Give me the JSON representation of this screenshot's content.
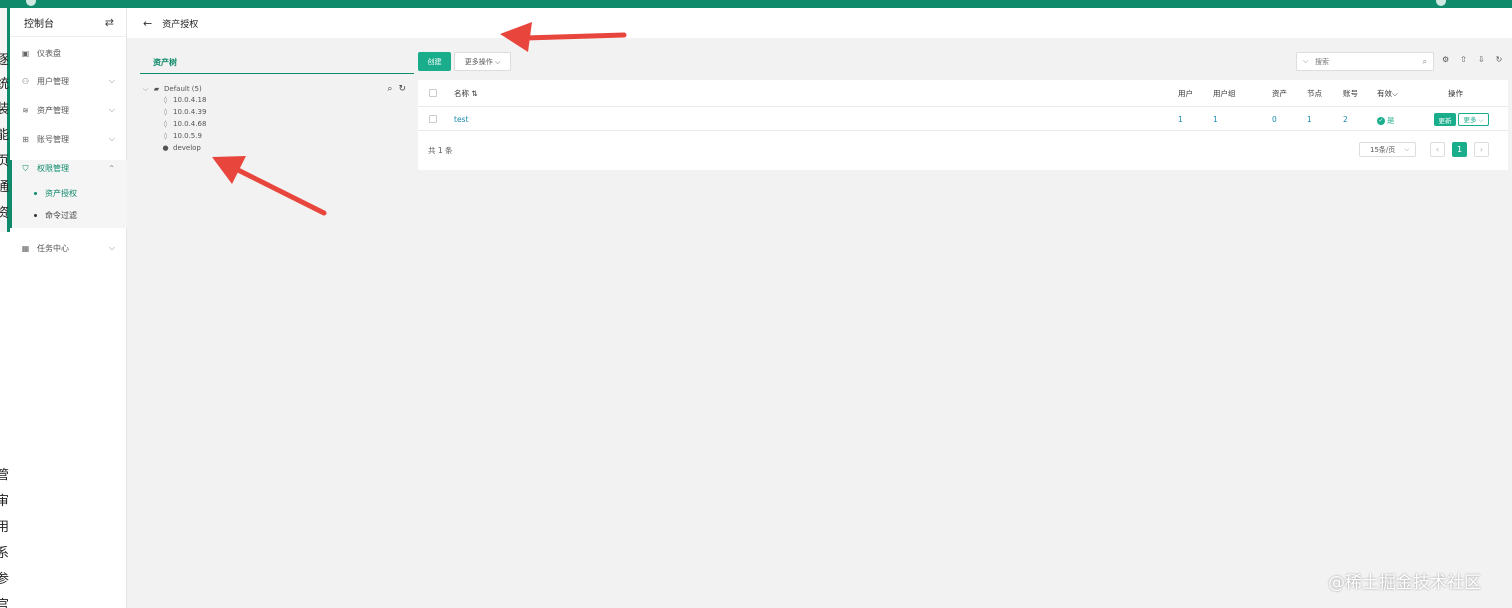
{
  "colors": {
    "accent": "#1aad8b",
    "topbar": "#0f8a6a",
    "link": "#1a8ab0",
    "annotation": "#e8463c"
  },
  "left_edge_chars": [
    "逐",
    "统",
    "装",
    "能",
    "页",
    "通",
    "资",
    "管",
    "审",
    "用",
    "系",
    "参",
    "官"
  ],
  "sidebar": {
    "title": "控制台",
    "swap_icon": "⇄",
    "items": [
      {
        "label": "仪表盘",
        "icon": "dashboard-icon"
      },
      {
        "label": "用户管理",
        "icon": "users-icon"
      },
      {
        "label": "资产管理",
        "icon": "assets-icon"
      },
      {
        "label": "账号管理",
        "icon": "accounts-icon"
      },
      {
        "label": "权限管理",
        "icon": "shield-icon"
      },
      {
        "label": "任务中心",
        "icon": "calendar-icon"
      }
    ],
    "sub_items": [
      {
        "label": "资产授权"
      },
      {
        "label": "命令过滤"
      }
    ]
  },
  "header": {
    "back_icon": "←",
    "title": "资产授权"
  },
  "tree": {
    "tab_label": "资产树",
    "root_label": "Default (5)",
    "nodes": [
      {
        "label": "10.0.4.18",
        "icon": "linux-icon"
      },
      {
        "label": "10.0.4.39",
        "icon": "linux-icon"
      },
      {
        "label": "10.0.4.68",
        "icon": "linux-icon"
      },
      {
        "label": "10.0.5.9",
        "icon": "linux-icon"
      },
      {
        "label": "develop",
        "icon": "node-icon"
      }
    ]
  },
  "toolbar": {
    "create_label": "创建",
    "more_actions_label": "更多操作 ⌵",
    "search_placeholder": "搜索"
  },
  "table": {
    "columns": [
      "名称 ⇅",
      "用户",
      "用户组",
      "资产",
      "节点",
      "账号",
      "有效⌵",
      "操作"
    ],
    "rows": [
      {
        "name": "test",
        "users": "1",
        "user_groups": "1",
        "assets": "0",
        "nodes": "1",
        "accounts": "2",
        "valid": "是"
      }
    ],
    "update_label": "更新",
    "row_more_label": "更多 ⌵",
    "total_label": "共 1 条",
    "page_size_label": "15条/页",
    "current_page": "1",
    "prev_icon": "‹",
    "next_icon": "›"
  },
  "watermark": "@稀土掘金技术社区"
}
